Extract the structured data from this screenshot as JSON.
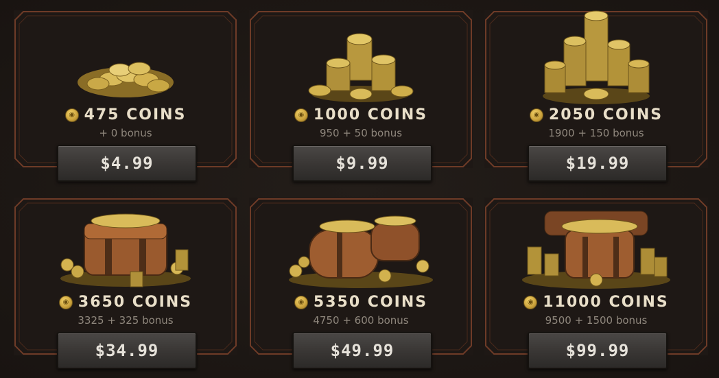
{
  "store": {
    "packs": [
      {
        "title": "475 COINS",
        "bonus": "+ 0 bonus",
        "price": "$4.99",
        "art": "small-coin-pile"
      },
      {
        "title": "1000 COINS",
        "bonus": "950 + 50 bonus",
        "price": "$9.99",
        "art": "coin-stacks"
      },
      {
        "title": "2050 COINS",
        "bonus": "1900 + 150 bonus",
        "price": "$19.99",
        "art": "large-coin-stacks"
      },
      {
        "title": "3650 COINS",
        "bonus": "3325 + 325 bonus",
        "price": "$34.99",
        "art": "coin-satchel"
      },
      {
        "title": "5350 COINS",
        "bonus": "4750 + 600 bonus",
        "price": "$49.99",
        "art": "coin-bags"
      },
      {
        "title": "11000 COINS",
        "bonus": "9500 + 1500 bonus",
        "price": "$99.99",
        "art": "treasure-hoard"
      }
    ]
  },
  "colors": {
    "frame": "#6e3b27",
    "gold": "#d4b04a",
    "background": "#1c1714",
    "button": "#3a3735",
    "title_text": "#e9dfc9"
  }
}
